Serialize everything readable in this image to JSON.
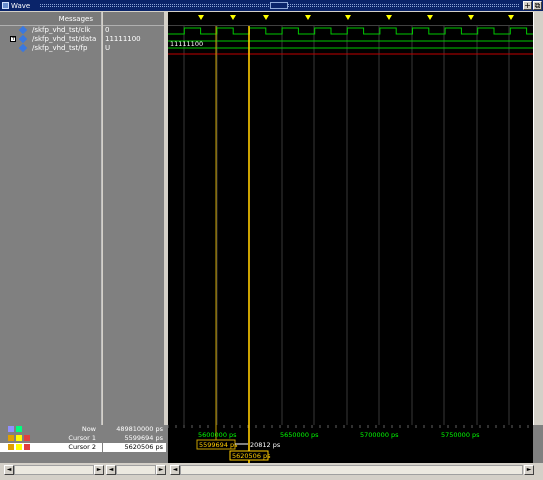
{
  "window": {
    "title": "Wave"
  },
  "header": {
    "messages_label": "Messages"
  },
  "signals": [
    {
      "name": "/skfp_vhd_tst/clk",
      "value": "0",
      "expandable": false
    },
    {
      "name": "/skfp_vhd_tst/data",
      "value": "11111100",
      "expandable": true
    },
    {
      "name": "/skfp_vhd_tst/fp",
      "value": "U",
      "expandable": false
    }
  ],
  "wave": {
    "data_bus_text": "11111100",
    "colors": {
      "clk": "#00c800",
      "data": "#00c800",
      "fp": "#c00000",
      "grid": "#707000",
      "cursor_selected": "#ffcc00",
      "cursor": "#c8a000",
      "bg": "#000000"
    }
  },
  "status": {
    "now_label": "Now",
    "now_value": "489810000 ps",
    "cursor1_label": "Cursor 1",
    "cursor1_value": "5599694 ps",
    "cursor2_label": "Cursor 2",
    "cursor2_value": "5620506 ps"
  },
  "timeline": {
    "ticks": [
      "5600000 ps",
      "5650000 ps",
      "5700000 ps",
      "5750000 ps"
    ],
    "cursor1_tag": "5599694 ps",
    "delta_tag": "20812 ps",
    "cursor2_tag": "5620506 ps"
  }
}
